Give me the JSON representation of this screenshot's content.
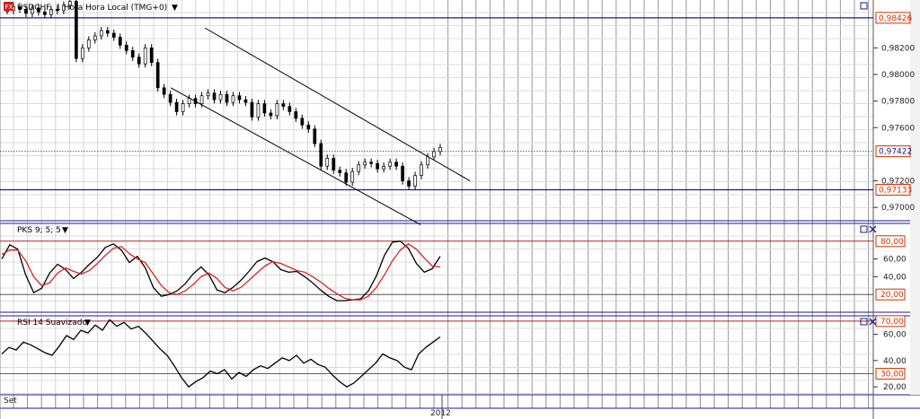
{
  "main": {
    "title": "USDCHF, 1 Hora Hora Local (TMG+0)",
    "dropdown_glyph": "▼",
    "icon": "fx-icon",
    "yticks": [
      "0,98200",
      "0,98000",
      "0,97800",
      "0,97600",
      "0,97200",
      "0,97000"
    ],
    "hlines": [
      {
        "value": "0,98426",
        "line_color": "#1a1a8c",
        "box_text_color": "#cc3300",
        "box_border": "#cc3300"
      },
      {
        "value": "0,97133",
        "line_color": "#1a1a8c",
        "box_text_color": "#cc3300",
        "box_border": "#cc3300"
      }
    ],
    "current_price": {
      "value": "0,97422",
      "line_color": "#cc3333",
      "box_text_color": "#1a1a8c",
      "box_border": "#cc3300"
    }
  },
  "pks": {
    "title": "PKS 9; 5; 5",
    "dropdown_glyph": "▼",
    "yticks": [
      "60,00",
      "40,00"
    ],
    "levels": [
      {
        "value": "80,00",
        "line_color": "#b22222",
        "box_text_color": "#cc3300"
      },
      {
        "value": "20,00",
        "line_color": "#555555",
        "box_text_color": "#cc3300"
      }
    ],
    "series_colors": {
      "k": "#000000",
      "d": "#dd2222"
    }
  },
  "rsi": {
    "title": "RSI 14 Suavizado",
    "dropdown_glyph": "▼",
    "yticks": [
      "60,00",
      "40,00",
      "20,00"
    ],
    "levels": [
      {
        "value": "70,00",
        "line_color": "#b22222",
        "box_text_color": "#cc3300"
      },
      {
        "value": "30,00",
        "line_color": "#228b22",
        "box_text_color": "#cc3300"
      }
    ],
    "series_color": "#000000"
  },
  "xaxis": {
    "labels": [
      "Set",
      "2012"
    ]
  },
  "chart_data": [
    {
      "type": "candlestick",
      "title": "USDCHF, 1 Hora Hora Local (TMG+0)",
      "ylim": [
        0.969,
        0.9856
      ],
      "price_levels": [
        0.98426,
        0.97133
      ],
      "current_price": 0.97422,
      "channel": {
        "upper": [
          [
            0.9835,
            0
          ],
          [
            0.972,
            1
          ]
        ],
        "lower": [
          [
            0.979,
            0
          ],
          [
            0.9687,
            1
          ]
        ]
      },
      "series": [
        {
          "name": "close",
          "values": [
            0.9848,
            0.9851,
            0.9849,
            0.9846,
            0.985,
            0.9847,
            0.9845,
            0.9849,
            0.9848,
            0.9852,
            0.9855,
            0.9812,
            0.982,
            0.9826,
            0.9829,
            0.9833,
            0.9831,
            0.9828,
            0.9822,
            0.9818,
            0.9813,
            0.9808,
            0.982,
            0.9809,
            0.979,
            0.9785,
            0.9779,
            0.9772,
            0.9778,
            0.9782,
            0.9778,
            0.9784,
            0.9786,
            0.9781,
            0.9785,
            0.9779,
            0.9784,
            0.9781,
            0.9779,
            0.9768,
            0.9778,
            0.9771,
            0.9769,
            0.9778,
            0.9776,
            0.9772,
            0.9767,
            0.9762,
            0.9759,
            0.9748,
            0.9731,
            0.9737,
            0.9728,
            0.9726,
            0.9719,
            0.9727,
            0.9732,
            0.9734,
            0.9733,
            0.9729,
            0.9731,
            0.9734,
            0.9731,
            0.972,
            0.9716,
            0.9724,
            0.9732,
            0.9738,
            0.9742,
            0.9745
          ]
        }
      ]
    },
    {
      "type": "line",
      "title": "PKS 9; 5; 5",
      "ylim": [
        0,
        100
      ],
      "levels": [
        80,
        20
      ],
      "series": [
        {
          "name": "%K",
          "values": [
            60,
            76,
            71,
            42,
            22,
            27,
            44,
            54,
            48,
            38,
            45,
            54,
            62,
            73,
            77,
            70,
            56,
            63,
            50,
            28,
            18,
            20,
            24,
            32,
            43,
            51,
            42,
            25,
            22,
            28,
            36,
            46,
            57,
            61,
            57,
            48,
            45,
            46,
            40,
            33,
            25,
            18,
            13,
            13,
            14,
            15,
            24,
            41,
            64,
            79,
            80,
            72,
            55,
            45,
            49,
            63
          ]
        },
        {
          "name": "%D",
          "values": [
            65,
            70,
            70,
            58,
            40,
            30,
            33,
            44,
            50,
            46,
            43,
            47,
            55,
            64,
            72,
            74,
            66,
            60,
            56,
            43,
            30,
            22,
            20,
            24,
            31,
            40,
            44,
            38,
            28,
            24,
            28,
            36,
            44,
            52,
            57,
            55,
            51,
            47,
            45,
            40,
            34,
            27,
            21,
            16,
            14,
            14,
            18,
            28,
            42,
            58,
            70,
            77,
            71,
            61,
            52,
            51
          ]
        }
      ]
    },
    {
      "type": "line",
      "title": "RSI 14 Suavizado",
      "ylim": [
        14,
        74
      ],
      "levels": [
        70,
        30
      ],
      "series": [
        {
          "name": "RSI",
          "values": [
            45,
            50,
            48,
            54,
            52,
            49,
            46,
            44,
            51,
            59,
            56,
            63,
            61,
            67,
            63,
            71,
            66,
            69,
            64,
            66,
            61,
            55,
            49,
            44,
            36,
            27,
            20,
            24,
            27,
            32,
            30,
            33,
            26,
            31,
            28,
            33,
            36,
            34,
            38,
            42,
            40,
            44,
            38,
            41,
            37,
            35,
            29,
            24,
            20,
            23,
            28,
            33,
            38,
            45,
            42,
            40,
            35,
            33,
            45,
            50,
            54,
            58
          ]
        }
      ]
    }
  ]
}
